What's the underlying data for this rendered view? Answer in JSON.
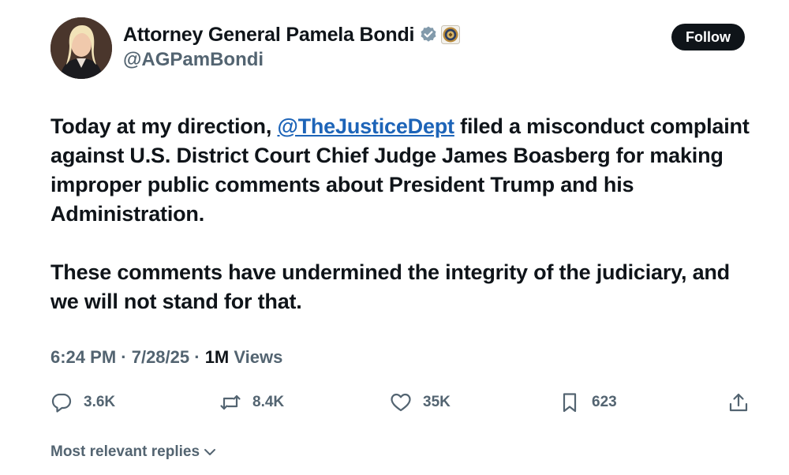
{
  "author": {
    "display_name": "Attorney General Pamela Bondi",
    "handle": "@AGPamBondi"
  },
  "follow_label": "Follow",
  "tweet": {
    "p1_before": "Today at my direction, ",
    "p1_mention": "@TheJusticeDept",
    "p1_after": " filed a misconduct complaint against U.S. District Court Chief Judge James Boasberg for making improper public comments about President Trump and his Administration.",
    "p2": "These comments have undermined the integrity of the judiciary, and we will not stand for that."
  },
  "meta": {
    "time": "6:24 PM",
    "sep1": " · ",
    "date": "7/28/25",
    "sep2": " · ",
    "views_count": "1M",
    "views_label": " Views"
  },
  "actions": {
    "replies": "3.6K",
    "reposts": "8.4K",
    "likes": "35K",
    "bookmarks": "623"
  },
  "replies_sort_label": "Most relevant replies",
  "colors": {
    "text": "#0f1419",
    "secondary": "#536471",
    "link": "#1d64b8",
    "verified": "#829aab"
  }
}
